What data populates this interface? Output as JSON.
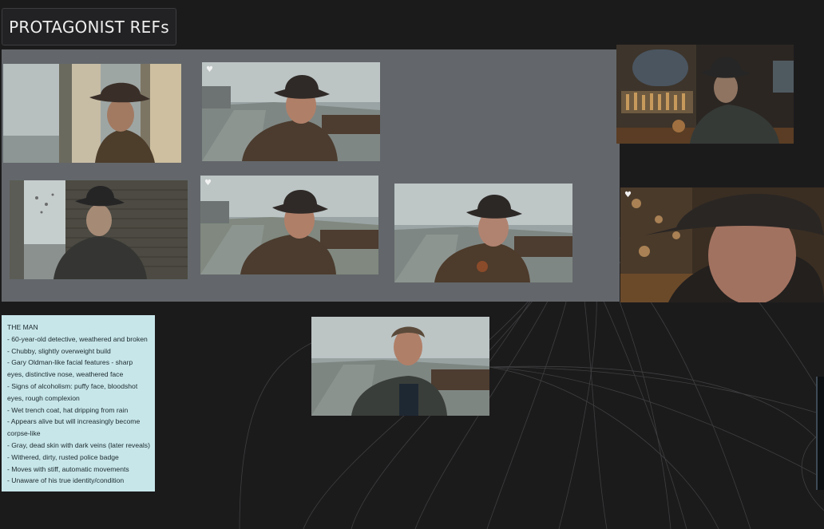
{
  "board": {
    "title": "PROTAGONIST REFs"
  },
  "icons": {
    "favorite": "heart-icon"
  },
  "images": [
    {
      "id": "window-rain",
      "favorited": false
    },
    {
      "id": "dock-hat-1",
      "favorited": true
    },
    {
      "id": "bar-drink",
      "favorited": false
    },
    {
      "id": "alley-smoke",
      "favorited": false
    },
    {
      "id": "dock-hat-2",
      "favorited": true
    },
    {
      "id": "dock-badge",
      "favorited": false
    },
    {
      "id": "bar-closeup",
      "favorited": true
    },
    {
      "id": "dock-no-hat",
      "favorited": false
    }
  ],
  "note": {
    "heading": "THE MAN",
    "lines": [
      "- 60-year-old detective, weathered and broken",
      "- Chubby, slightly overweight build",
      "- Gary Oldman-like facial features - sharp eyes, distinctive nose, weathered face",
      "- Signs of alcoholism: puffy face, bloodshot eyes, rough complexion",
      "- Wet trench coat, hat dripping from rain",
      "- Appears alive but will increasingly become corpse-like",
      "- Gray, dead skin with dark veins (later reveals)",
      "- Withered, dirty, rusted police badge",
      "- Moves with stiff, automatic movements",
      "- Unaware of his true identity/condition"
    ]
  },
  "colors": {
    "canvas": "#1c1b1c",
    "group": "#63676b",
    "note": "#c7e6ea"
  }
}
